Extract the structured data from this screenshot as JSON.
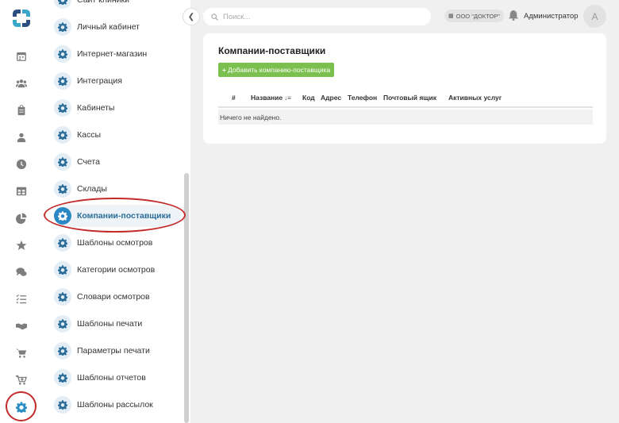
{
  "rail": {
    "items": [
      {
        "name": "calendar-icon"
      },
      {
        "name": "users-icon"
      },
      {
        "name": "clipboard-icon"
      },
      {
        "name": "user-icon"
      },
      {
        "name": "clock-icon"
      },
      {
        "name": "table-icon"
      },
      {
        "name": "pie-chart-icon"
      },
      {
        "name": "star-icon"
      },
      {
        "name": "chat-icon"
      },
      {
        "name": "checklist-icon"
      },
      {
        "name": "handshake-icon"
      },
      {
        "name": "cart-icon"
      },
      {
        "name": "cart-plus-icon"
      },
      {
        "name": "settings-gear-icon"
      }
    ]
  },
  "sub_sidebar": {
    "items": [
      {
        "label": "Сайт клиники"
      },
      {
        "label": "Личный кабинет"
      },
      {
        "label": "Интернет-магазин"
      },
      {
        "label": "Интеграция"
      },
      {
        "label": "Кабинеты"
      },
      {
        "label": "Кассы"
      },
      {
        "label": "Счета"
      },
      {
        "label": "Склады"
      },
      {
        "label": "Компании-поставщики",
        "active": true
      },
      {
        "label": "Шаблоны осмотров"
      },
      {
        "label": "Категории осмотров"
      },
      {
        "label": "Словари осмотров"
      },
      {
        "label": "Шаблоны печати"
      },
      {
        "label": "Параметры печати"
      },
      {
        "label": "Шаблоны отчетов"
      },
      {
        "label": "Шаблоны рассылок"
      }
    ]
  },
  "topbar": {
    "search_placeholder": "Поиск...",
    "org": "ООО \"ДОКТОР\"",
    "user_name": "Администратор",
    "avatar_letter": "А"
  },
  "main": {
    "title": "Компании-поставщики",
    "add_button": "Добавить компанию-поставщика",
    "columns": [
      "#",
      "Название",
      "Код",
      "Адрес",
      "Телефон",
      "Почтовый ящик",
      "Активных услуг"
    ],
    "empty_text": "Ничего не найдено."
  },
  "colors": {
    "accent": "#2a88c4",
    "add_button": "#7bbf4e",
    "highlight_circle": "#c32a2a"
  }
}
